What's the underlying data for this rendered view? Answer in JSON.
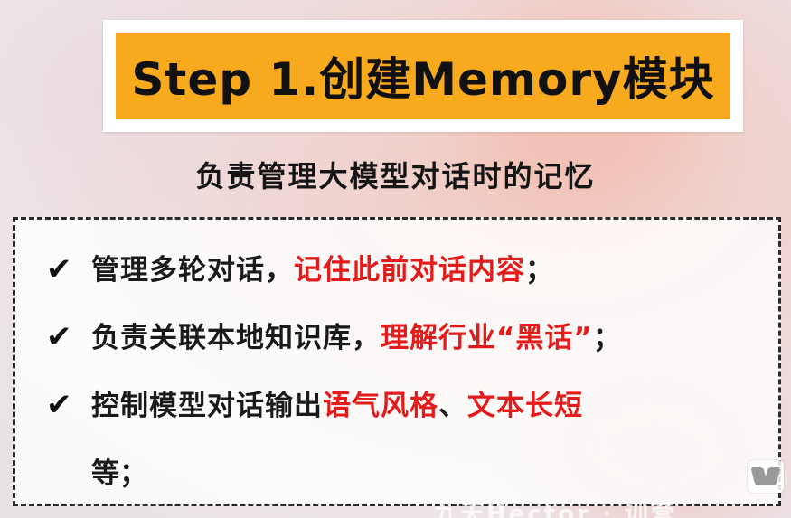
{
  "title": "Step 1.创建Memory模块",
  "subtitle": "负责管理大模型对话时的记忆",
  "items": [
    {
      "check": "✔",
      "normal": "管理多轮对话，",
      "highlight": "记住此前对话内容",
      "end": "；"
    },
    {
      "check": "✔",
      "normal": "负责关联本地知识库，",
      "highlight": "理解行业“黑话”",
      "end": "；"
    },
    {
      "check": "✔",
      "normal": "控制模型对话输出",
      "highlight1": "语气风格",
      "sep": "、",
      "highlight2": "文本长短"
    }
  ],
  "continuation": "等；",
  "watermark": "九天Hector · 训营",
  "icons": {
    "check": "check-icon",
    "logo": "corner-logo-icon"
  },
  "colors": {
    "title_bg": "#f7aa1e",
    "highlight": "#e21b1b"
  }
}
